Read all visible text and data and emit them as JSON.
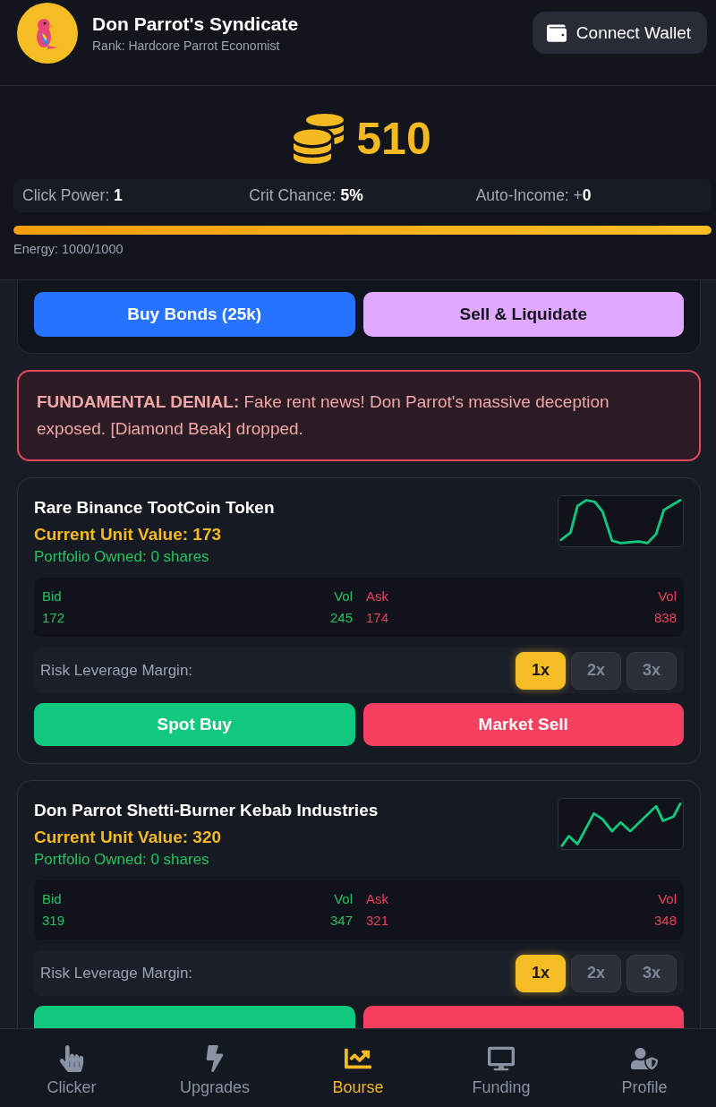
{
  "header": {
    "title": "Don Parrot's Syndicate",
    "subtitle": "Rank: Hardcore Parrot Economist",
    "wallet_button": "Connect Wallet"
  },
  "balance": {
    "amount": "510"
  },
  "stats": [
    "Click Power: **1**",
    "Crit Chance: **5%**",
    "Auto-Income: +**0**"
  ],
  "energy": {
    "level": 1,
    "label": "Energy: 1000/1000"
  },
  "bond_card": {
    "buttons": [
      {
        "label": "Buy Bonds (25k)",
        "kind": "buy"
      },
      {
        "label": "Sell & Liquidate",
        "kind": "sell"
      }
    ]
  },
  "alert": {
    "text": "**FUNDAMENTAL DENIAL:** Fake rent news! Don Parrot's massive deception exposed. [Diamond Beak] dropped."
  },
  "stocks": [
    {
      "name": "Rare Binance TootCoin Token",
      "value": "Current Unit Value: 173",
      "owned": "Portfolio Owned: 0 shares",
      "book": {
        "bid_header": "Bid",
        "bid_vol_header": "Vol",
        "ask_header": "Ask",
        "ask_vol_header": "Vol",
        "bid": "172",
        "bid_vol": "245",
        "ask": "174",
        "ask_vol": "838"
      },
      "leverage_label": "Risk Leverage Margin:",
      "leverage": [
        {
          "label": "1x",
          "selected": true
        },
        {
          "label": "2x",
          "selected": false
        },
        {
          "label": "3x",
          "selected": false
        }
      ],
      "actions": [
        {
          "label": "Spot Buy",
          "kind": "buy"
        },
        {
          "label": "Market Sell",
          "kind": "sell"
        }
      ]
    },
    {
      "name": "Don Parrot Shetti-Burner Kebab Industries",
      "value": "Current Unit Value: 320",
      "owned": "Portfolio Owned: 0 shares",
      "book": {
        "bid_header": "Bid",
        "bid_vol_header": "Vol",
        "ask_header": "Ask",
        "ask_vol_header": "Vol",
        "bid": "319",
        "bid_vol": "347",
        "ask": "321",
        "ask_vol": "348"
      },
      "leverage_label": "Risk Leverage Margin:",
      "leverage": [
        {
          "label": "1x",
          "selected": true
        },
        {
          "label": "2x",
          "selected": false
        },
        {
          "label": "3x",
          "selected": false
        }
      ],
      "actions": [
        {
          "kind": "buy"
        },
        {
          "kind": "sell"
        }
      ]
    }
  ],
  "nav": [
    {
      "label": "Clicker",
      "selected": false
    },
    {
      "label": "Upgrades",
      "selected": false
    },
    {
      "label": "Bourse",
      "selected": true
    },
    {
      "label": "Funding",
      "selected": false
    },
    {
      "label": "Profile",
      "selected": false
    }
  ]
}
